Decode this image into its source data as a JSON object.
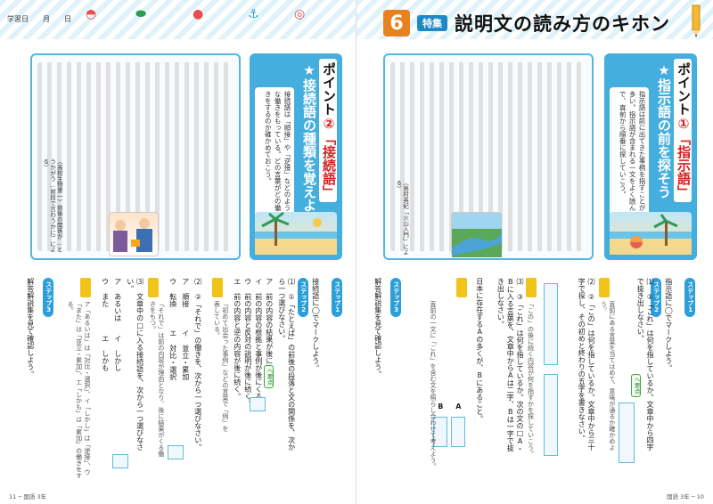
{
  "header": {
    "date_label": "学習日",
    "month_label": "月",
    "day_label": "日",
    "special_label": "特集",
    "number": "6",
    "title": "説明文の読み方のキホン"
  },
  "left_page": {
    "point_label": "ポイント",
    "point_number": "②",
    "point_keyword": "「接続語」",
    "point_subtitle": "★接続語の種類を覚えよう",
    "point_desc": "接続語は「順接」や「逆接」などのような働きをもっている。どの言葉がどの働きをするのか確かめておこう。",
    "passage_caption": "（高校生物第一）前後の関係が…とうかがう…前段で言わうかに）による）",
    "step1_label": "ステップ1",
    "step1_text": "接続語に◯でマークしよう。",
    "step2_label": "ステップ2",
    "q1_title": "⑴ ①「たとえば」の前後の段落と文の関係を、次から一つ選びなさい。",
    "q1_options": [
      "ア 前の内容の結果が後にくる。",
      "イ 前の内容の根拠と事例が後にくる。",
      "ウ 前の内容と反対の説明が後に続く。",
      "エ 前の内容と逆の内容が後に続く。"
    ],
    "q1_note": "「初めて出会った事例」などの言葉で「例」を表している。",
    "q2_title": "⑵ ②「それで」の働きを、次から一つ選びなさい。",
    "q2_options": [
      "ア 順接",
      "イ 並立・累加",
      "ウ 転換",
      "エ 対比・選択"
    ],
    "q2_note": "「それで」は前の内容が理由となり、後に結果がくる働きをもつ。",
    "q3_title": "⑶ 文章中の□に入る接続語を、次から一つ選びなさい。",
    "q3_options": [
      "ア あるいは",
      "イ しかし",
      "ウ また",
      "エ しかも"
    ],
    "q3_note": "ア「あるいは」は「対比・選択」、イ「しかし」は「逆接」、ウ「また」は「並立・累加」、エ「しかも」は「累加」の働きをする。",
    "step3_label": "ステップ3",
    "step3_text": "解答解説集を見て確認しよう。",
    "folio": "11 ─ 国語 3年"
  },
  "right_page": {
    "point_label": "ポイント",
    "point_number": "①",
    "point_keyword": "「指示語」",
    "point_subtitle": "★指示語の前を探そう",
    "point_desc": "指示語は前に出てきた事柄を指すことが多い。指示語が含まれる一文をよく読んで、直前から順番に探していこう。",
    "passage_caption": "（島村英紀「火山入門」による）",
    "step1_label": "ステップ1",
    "step1_text": "指示語に◯でマークしよう。",
    "step2_label": "ステップ2",
    "q1_title": "⑴ ①「これ」は何を指しているか。文章中から四字で抜き出しなさい。",
    "q1_note": "直前にある言葉を当てはめて、意味が通るか確かめよう。",
    "q2_title": "⑵ ②「この」は何を指しているか。文章中から三十字で探し、その初めと終わりの五字を書きなさい。",
    "q2_note": "「この」の後に続く内容が何を指すかを探していこう。",
    "q3_title": "⑶ ③「これ」は何を指しているか。次の文の□A・Bに入る言葉を、文章中からAは二字、Bは一字で抜き出しなさい。",
    "q3_sentence": "日本に存在するAの多くが、Bにあること。",
    "q3_note": "直前の一文に「これ」を含む文を照らし合わせて考えよう。",
    "label_a": "A",
    "label_b": "B",
    "step3_label": "ステップ3",
    "step3_text": "解答解説集を見て確認しよう。",
    "folio": "国語 3年 ─ 10"
  },
  "badges": {
    "green": "ヘ要点",
    "hint": "ヒント"
  },
  "colors": {
    "accent_blue": "#44aede",
    "accent_orange": "#e8821e",
    "accent_red": "#d62020"
  }
}
